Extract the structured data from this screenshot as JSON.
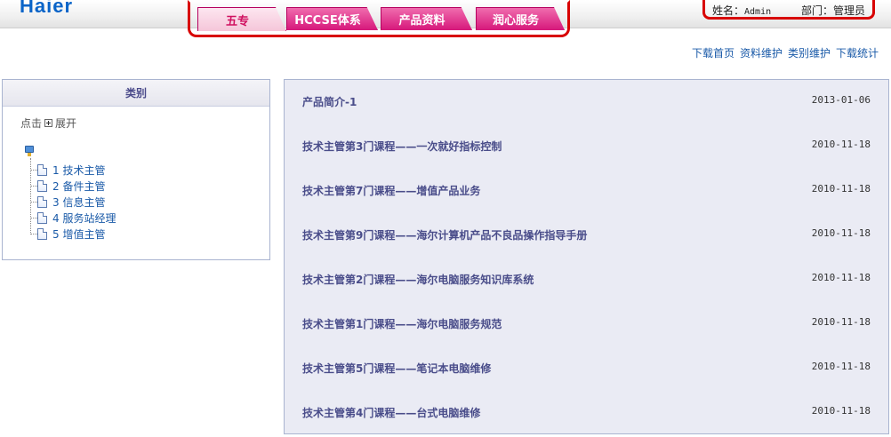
{
  "header": {
    "logo": "Haier",
    "tabs": [
      {
        "label": "五专"
      },
      {
        "label": "HCCSE体系"
      },
      {
        "label": "产品资料"
      },
      {
        "label": "润心服务"
      }
    ],
    "user": {
      "name_label": "姓名：",
      "name_value": "Admin",
      "dept_label": "部门：",
      "dept_value": "管理员"
    }
  },
  "toplinks": [
    "下载首页",
    "资料维护",
    "类别维护",
    "下载统计"
  ],
  "sidebar": {
    "title": "类别",
    "expand_prefix": "点击",
    "expand_label": "展开",
    "items": [
      {
        "label": "1 技术主管"
      },
      {
        "label": "2 备件主管"
      },
      {
        "label": "3 信息主管"
      },
      {
        "label": "4 服务站经理"
      },
      {
        "label": "5 增值主管"
      }
    ]
  },
  "list": [
    {
      "title": "产品简介-1",
      "date": "2013-01-06"
    },
    {
      "title": "技术主管第3门课程——一次就好指标控制",
      "date": "2010-11-18"
    },
    {
      "title": "技术主管第7门课程——增值产品业务",
      "date": "2010-11-18"
    },
    {
      "title": "技术主管第9门课程——海尔计算机产品不良品操作指导手册",
      "date": "2010-11-18"
    },
    {
      "title": "技术主管第2门课程——海尔电脑服务知识库系统",
      "date": "2010-11-18"
    },
    {
      "title": "技术主管第1门课程——海尔电脑服务规范",
      "date": "2010-11-18"
    },
    {
      "title": "技术主管第5门课程——笔记本电脑维修",
      "date": "2010-11-18"
    },
    {
      "title": "技术主管第4门课程——台式电脑维修",
      "date": "2010-11-18"
    }
  ]
}
